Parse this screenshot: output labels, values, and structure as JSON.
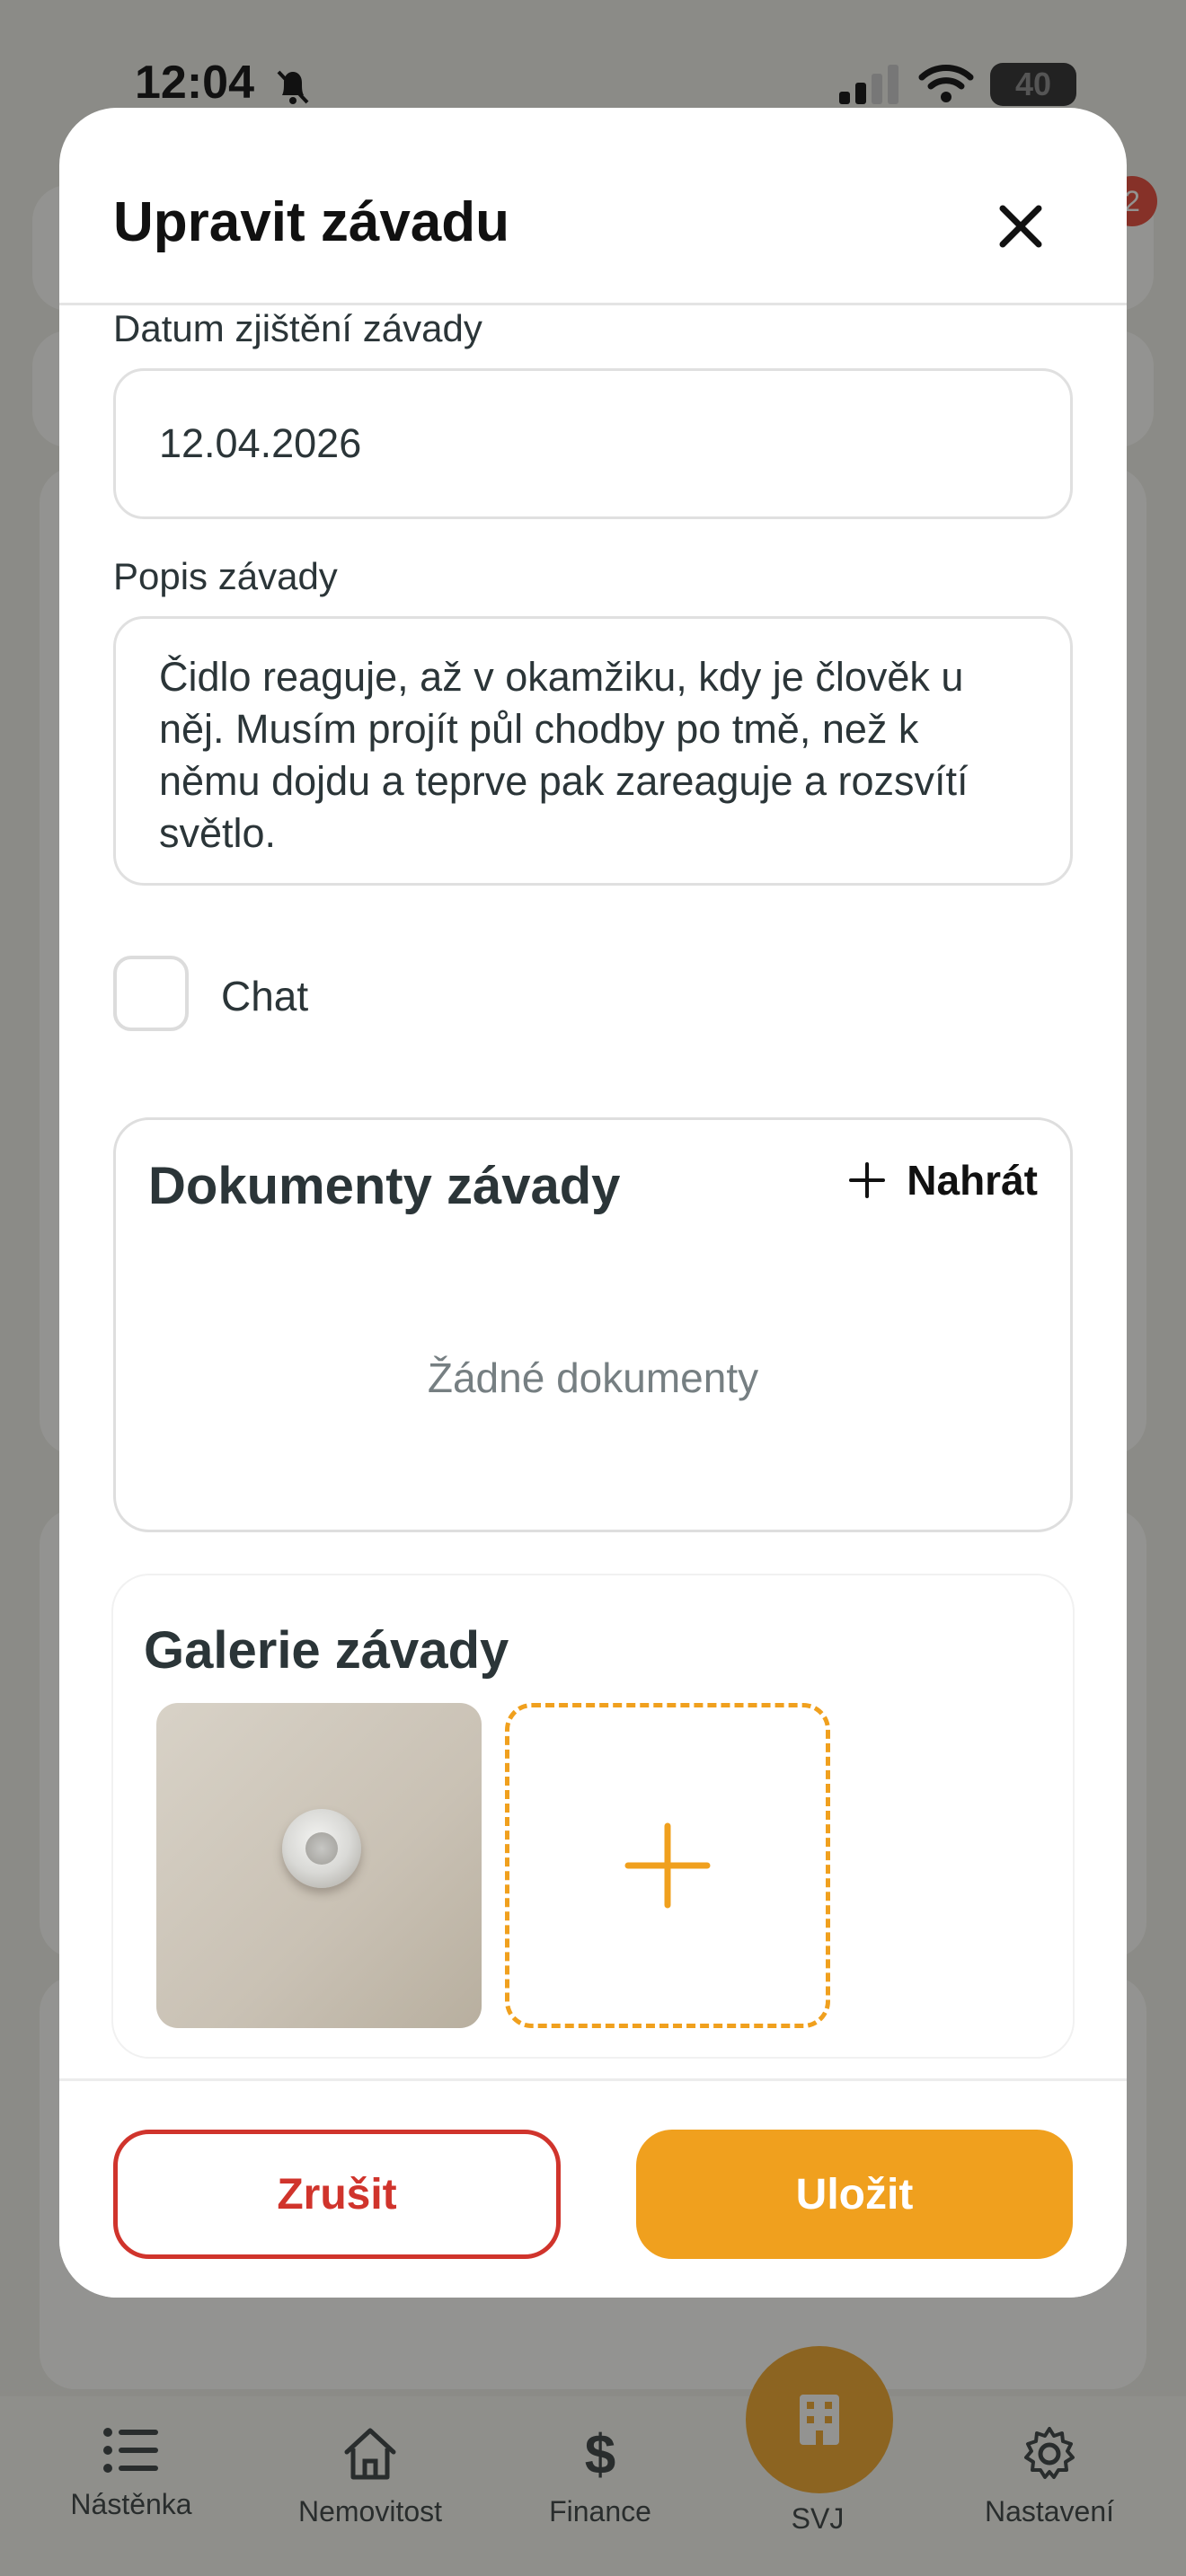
{
  "status_bar": {
    "time": "12:04",
    "battery": "40"
  },
  "background": {
    "badge_count": "2"
  },
  "modal": {
    "title": "Upravit závadu",
    "date_field": {
      "label": "Datum zjištění závady",
      "value": "12.04.2026"
    },
    "description_field": {
      "label": "Popis závady",
      "lines": [
        "Čidlo reaguje, až v okamžiku, kdy je člověk u",
        "něj. Musím projít půl chodby po tmě, než k",
        "němu dojdu a teprve pak zareaguje a rozsvítí",
        "světlo."
      ]
    },
    "chat_checkbox": {
      "label": "Chat",
      "checked": false
    },
    "documents": {
      "title": "Dokumenty závady",
      "upload_label": "Nahrát",
      "empty_text": "Žádné dokumenty"
    },
    "gallery": {
      "title": "Galerie závady"
    },
    "footer": {
      "cancel_label": "Zrušit",
      "save_label": "Uložit"
    }
  },
  "tabbar": {
    "items": [
      {
        "label": "Nástěnka",
        "icon": "list-icon"
      },
      {
        "label": "Nemovitost",
        "icon": "house-icon"
      },
      {
        "label": "Finance",
        "icon": "dollar-icon"
      },
      {
        "label": "SVJ",
        "icon": "building-icon"
      },
      {
        "label": "Nastavení",
        "icon": "gear-icon"
      }
    ]
  },
  "colors": {
    "accent": "#f0a01e",
    "danger": "#d0342c",
    "text": "#2b3538"
  }
}
